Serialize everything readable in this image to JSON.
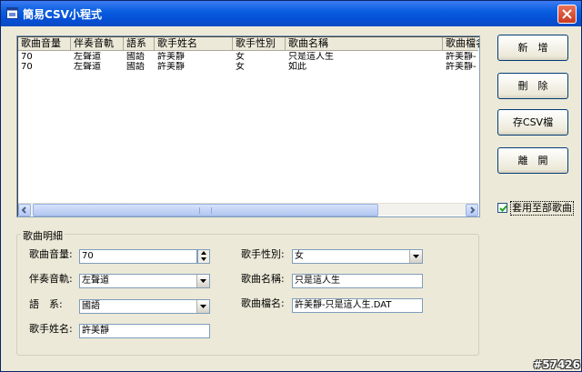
{
  "window": {
    "title": "簡易CSV小程式"
  },
  "list": {
    "columns": [
      "歌曲音量",
      "伴奏音軌",
      "語系",
      "歌手姓名",
      "歌手性別",
      "歌曲名稱",
      "歌曲檔名"
    ],
    "rows": [
      [
        "70",
        "左聲道",
        "國語",
        "許美靜",
        "女",
        "只是這人生",
        "許美靜-"
      ],
      [
        "70",
        "左聲道",
        "國語",
        "許美靜",
        "女",
        "如此",
        "許美靜-"
      ]
    ]
  },
  "buttons": {
    "add": "新　增",
    "delete": "刪　除",
    "save_csv": "存CSV檔",
    "exit": "離　開"
  },
  "checkbox": {
    "label": "套用至部歌曲",
    "checked": true
  },
  "details": {
    "title": "歌曲明細",
    "volume_label": "歌曲音量:",
    "volume_value": "70",
    "track_label": "伴奏音軌:",
    "track_value": "左聲道",
    "language_label": "語　系:",
    "language_value": "國語",
    "singer_label": "歌手姓名:",
    "singer_value": "許美靜",
    "gender_label": "歌手性別:",
    "gender_value": "女",
    "song_label": "歌曲名稱:",
    "song_value": "只是這人生",
    "file_label": "歌曲檔名:",
    "file_value": "許美靜-只是這人生.DAT"
  },
  "watermark": "#57426"
}
